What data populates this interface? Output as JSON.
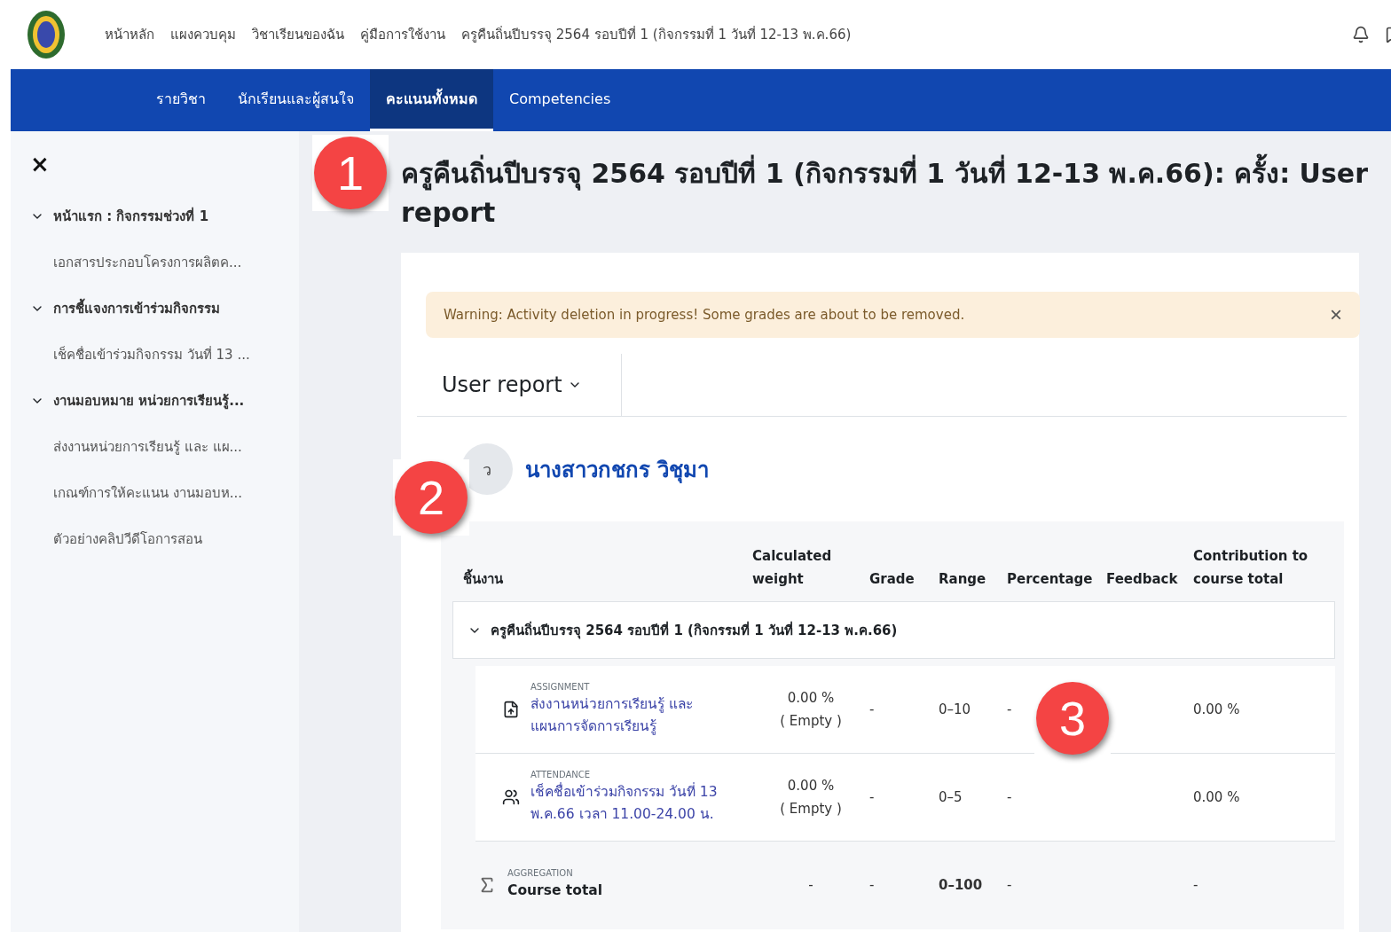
{
  "header": {
    "nav": [
      "หน้าหลัก",
      "แผงควบคุม",
      "วิชาเรียนของฉัน",
      "คู่มือการใช้งาน",
      "ครูคืนถิ่นปีบรรจุ 2564 รอบปีที่ 1 (กิจกรรมที่ 1 วันที่ 12-13 พ.ค.66)"
    ]
  },
  "course_nav": {
    "tabs": [
      {
        "label": "รายวิชา",
        "selected": false
      },
      {
        "label": "นักเรียนและผู้สนใจ",
        "selected": false
      },
      {
        "label": "คะแนนทั้งหมด",
        "selected": true
      },
      {
        "label": "Competencies",
        "selected": false
      }
    ]
  },
  "sidebar": {
    "close": "×",
    "sections": [
      {
        "title": "หน้าแรก : กิจกรรมช่วงที่ 1",
        "expanded": true,
        "children": [
          "เอกสารประกอบโครงการผลิตค..."
        ]
      },
      {
        "title": "การชี้แจงการเข้าร่วมกิจกรรม",
        "expanded": true,
        "children": [
          "เช็คชื่อเข้าร่วมกิจกรรม วันที่ 13 ..."
        ]
      },
      {
        "title": "งานมอบหมาย หน่วยการเรียนรู้...",
        "expanded": true,
        "children": [
          "ส่งงานหน่วยการเรียนรู้ และ แผ...",
          "เกณฑ์การให้คะแนน งานมอบห...",
          "ตัวอย่างคลิปวีดีโอการสอน"
        ]
      }
    ]
  },
  "page_title": "ครูคืนถิ่นปีบรรจุ 2564 รอบปีที่ 1 (กิจกรรมที่ 1 วันที่ 12-13 พ.ค.66): ครั้ง: User report",
  "alert": {
    "message": "Warning: Activity deletion in progress! Some grades are about to be removed.",
    "close": "×"
  },
  "report_selector": "User report",
  "user": {
    "initials": "ว",
    "name": "นางสาวกชกร วิชุมา"
  },
  "table": {
    "columns": [
      "ชิ้นงาน",
      "Calculated weight",
      "Grade",
      "Range",
      "Percentage",
      "Feedback",
      "Contribution to course total"
    ],
    "category": {
      "name": "ครูคืนถิ่นปีบรรจุ 2564 รอบปีที่ 1 (กิจกรรมที่ 1 วันที่ 12-13 พ.ค.66)",
      "expanded": true
    },
    "rows": [
      {
        "kind": "assignment",
        "type_label": "ASSIGNMENT",
        "name": "ส่งงานหน่วยการเรียนรู้ และ แผนการจัดการเรียนรู้",
        "weight": [
          "0.00 %",
          "( Empty )"
        ],
        "grade": "-",
        "range": "0–10",
        "percentage": "-",
        "contribution": "0.00 %"
      },
      {
        "kind": "attendance",
        "type_label": "ATTENDANCE",
        "name": "เช็คชื่อเข้าร่วมกิจกรรม วันที่ 13 พ.ค.66 เวลา 11.00-24.00 น.",
        "weight": [
          "0.00 %",
          "( Empty )"
        ],
        "grade": "-",
        "range": "0–5",
        "percentage": "-",
        "contribution": "0.00 %"
      },
      {
        "kind": "aggregation",
        "type_label": "AGGREGATION",
        "name": "Course total",
        "weight": [
          "-"
        ],
        "grade": "-",
        "range": "0–100",
        "percentage": "-",
        "contribution": "-"
      }
    ]
  },
  "callouts": [
    "1",
    "2",
    "3"
  ]
}
